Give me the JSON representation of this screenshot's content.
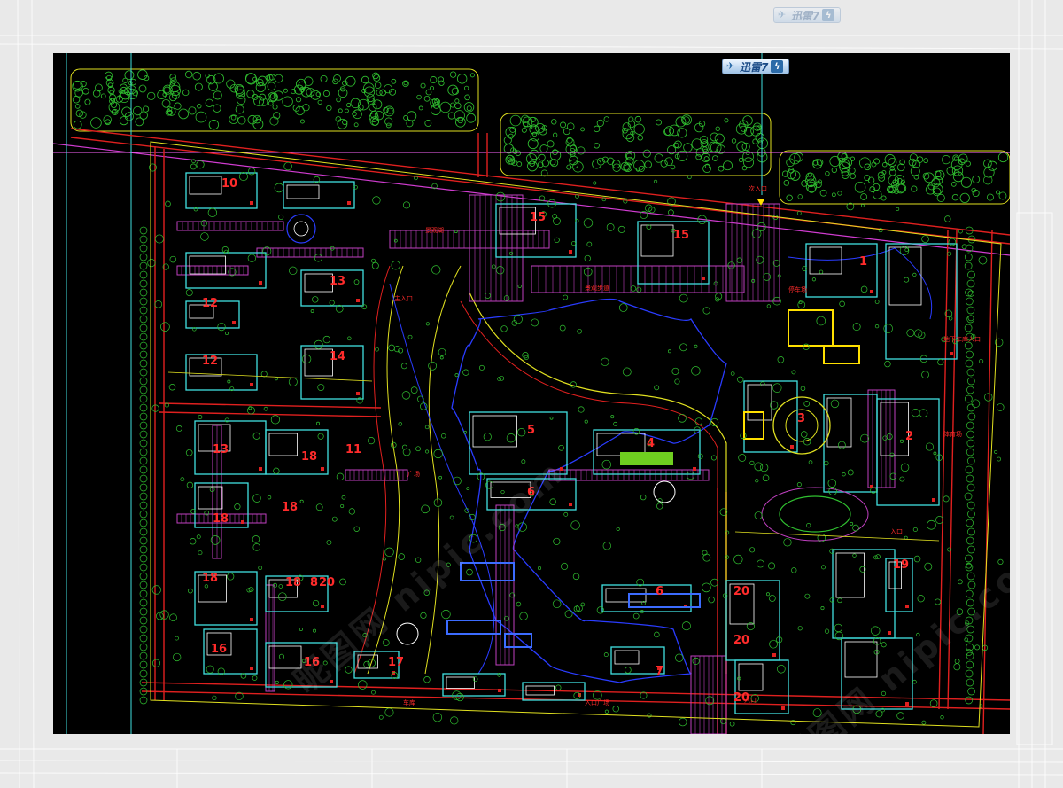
{
  "app": {
    "badge_text": "迅雷7",
    "badge_icon": "lightning-bolt-icon",
    "badge_bird_icon": "xunlei-bird-icon"
  },
  "plan": {
    "background_color": "#000000",
    "line_colors": {
      "road": "#e0201f",
      "path": "#c040c0",
      "building": "#40e0e0",
      "vegetation": "#30c030",
      "water": "#2a3cff",
      "boundary": "#e0e020"
    },
    "building_labels": [
      "10",
      "13",
      "12",
      "12",
      "14",
      "15",
      "15",
      "1",
      "2",
      "3",
      "4",
      "5",
      "6",
      "6",
      "7",
      "8",
      "13",
      "18",
      "18",
      "18",
      "16",
      "16",
      "17",
      "18",
      "18",
      "19",
      "20",
      "20",
      "20",
      "20",
      "11"
    ],
    "annotations": [
      "景观湖",
      "主入口",
      "次入口",
      "停车场",
      "广场",
      "地下车库入口",
      "体育场",
      "入口",
      "入口广场",
      "景观步道",
      "入口",
      "车库"
    ],
    "watermark_text": "昵图网 nipic.com"
  }
}
